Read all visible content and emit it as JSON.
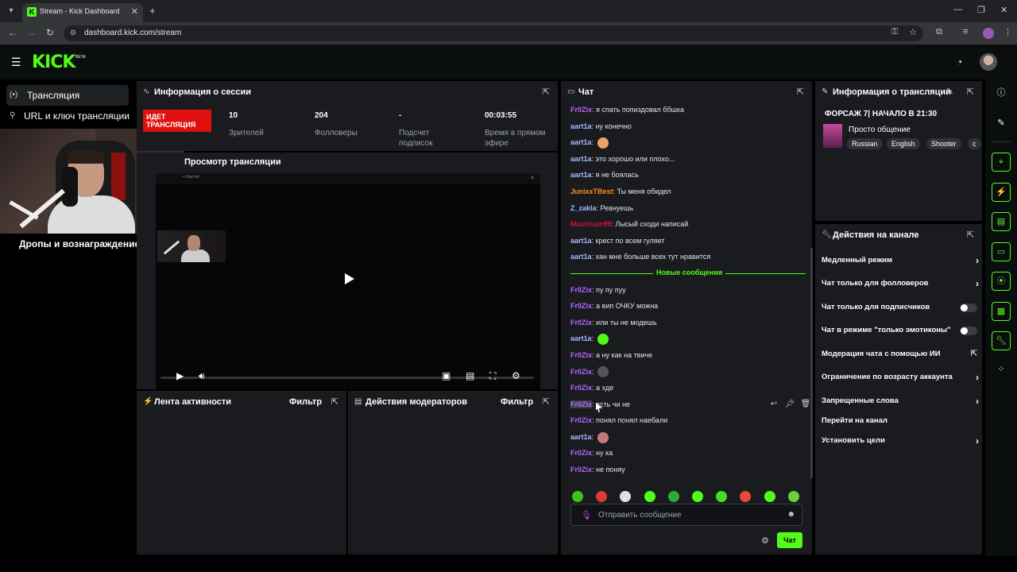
{
  "browser": {
    "tab_title": "Stream - Kick Dashboard",
    "url": "dashboard.kick.com/stream"
  },
  "header": {
    "logo": "KICK",
    "logo_badge": "BETA"
  },
  "sidebar": {
    "items": [
      {
        "label": "Трансляция",
        "icon": "broadcast-icon"
      },
      {
        "label": "URL и ключ трансляции",
        "icon": "key-icon"
      },
      {
        "label": "Дропы и вознаграждение",
        "icon": "gift-icon"
      }
    ]
  },
  "session": {
    "title": "Информация о сессии",
    "live_label": "ИДЕТ ТРАНСЛЯЦИЯ",
    "stats": [
      {
        "value": "10",
        "label": "Зрителей"
      },
      {
        "value": "204",
        "label": "Фолловеры"
      },
      {
        "value": "-",
        "label": "Подсчет подписок"
      },
      {
        "value": "00:03:55",
        "label": "Время в прямом эфире"
      }
    ]
  },
  "preview": {
    "title": "Просмотр трансляции"
  },
  "activity": {
    "title": "Лента активности",
    "filter": "Фильтр"
  },
  "mod_actions": {
    "title": "Действия модераторов",
    "filter": "Фильтр"
  },
  "chat": {
    "title": "Чат",
    "messages_before": [
      {
        "user": "Fr0Zix",
        "color": "#b866ff",
        "text": "я спать попиздовал ббшка"
      },
      {
        "user": "aart1a",
        "color": "#a9b8ff",
        "text": "ну конечно"
      },
      {
        "user": "aart1a",
        "color": "#a9b8ff",
        "text": "",
        "emote": "#e8a36a"
      },
      {
        "user": "aart1a",
        "color": "#a9b8ff",
        "text": "это хорошо или плохо..."
      },
      {
        "user": "aart1a",
        "color": "#a9b8ff",
        "text": "я не боялась"
      },
      {
        "user": "JunixxTBest",
        "color": "#ff8c1a",
        "text": "Ты меня обидел"
      },
      {
        "user": "Z_zakla",
        "color": "#a9b8ff",
        "text": "Ревнуешь"
      },
      {
        "user": "Maximum99",
        "color": "#c8143c",
        "text": "Лысый сходи написай"
      },
      {
        "user": "aart1a",
        "color": "#a9b8ff",
        "text": "крест по всем гуляет"
      },
      {
        "user": "aart1a",
        "color": "#a9b8ff",
        "text": "хан мне больше всех тут нравится"
      }
    ],
    "new_messages_label": "Новые сообщения",
    "messages_after": [
      {
        "user": "Fr0Zix",
        "color": "#b866ff",
        "text": "пу пу пуу"
      },
      {
        "user": "Fr0Zix",
        "color": "#b866ff",
        "text": "а вип ОЧКУ можна"
      },
      {
        "user": "Fr0Zix",
        "color": "#b866ff",
        "text": "или ты не модешь"
      },
      {
        "user": "aart1a",
        "color": "#a9b8ff",
        "text": "",
        "emote": "#53fc18"
      },
      {
        "user": "Fr0Zix",
        "color": "#b866ff",
        "text": "а ну как на твиче"
      },
      {
        "user": "Fr0Zix",
        "color": "#b866ff",
        "text": "",
        "emote": "#555555"
      },
      {
        "user": "Fr0Zix",
        "color": "#b866ff",
        "text": "а хде"
      },
      {
        "user": "Fr0Zix",
        "color": "#b866ff",
        "text": "есть чи не"
      },
      {
        "user": "Fr0Zix",
        "color": "#b866ff",
        "text": "понял понял наебали"
      },
      {
        "user": "aart1a",
        "color": "#a9b8ff",
        "text": "",
        "emote": "#c47a7a"
      },
      {
        "user": "Fr0Zix",
        "color": "#b866ff",
        "text": "ну ка"
      },
      {
        "user": "Fr0Zix",
        "color": "#b866ff",
        "text": "не поняу"
      }
    ],
    "input_placeholder": "Отправить сообщение",
    "send_label": "Чат",
    "emote_colors": [
      "#3ec21a",
      "#d93a3a",
      "#e0e0e0",
      "#53fc18",
      "#2faa3a",
      "#53fc18",
      "#44dd22",
      "#e84a3a",
      "#53fc18",
      "#6ad23a"
    ]
  },
  "stream_info": {
    "title": "Информация о трансляции",
    "stream_title": "ФОРСАЖ 7| НАЧАЛО В 21:30",
    "category": "Просто общение",
    "tags": [
      "Russian",
      "English",
      "Shooter",
      "c"
    ]
  },
  "channel_actions": {
    "title": "Действия на канале",
    "rows": [
      {
        "label": "Медленный режим",
        "type": "chevron"
      },
      {
        "label": "Чат только для фолловеров",
        "type": "chevron"
      },
      {
        "label": "Чат только для подписчиков",
        "type": "toggle"
      },
      {
        "label": "Чат в режиме \"только эмотиконы\"",
        "type": "toggle"
      },
      {
        "label": "Модерация чата с помощью ИИ",
        "type": "external"
      },
      {
        "label": "Ограничение по возрасту аккаунта",
        "type": "chevron"
      },
      {
        "label": "Запрещенные слова",
        "type": "chevron"
      },
      {
        "label": "Перейти на канал",
        "type": "none"
      },
      {
        "label": "Установить цели",
        "type": "chevron"
      }
    ]
  }
}
